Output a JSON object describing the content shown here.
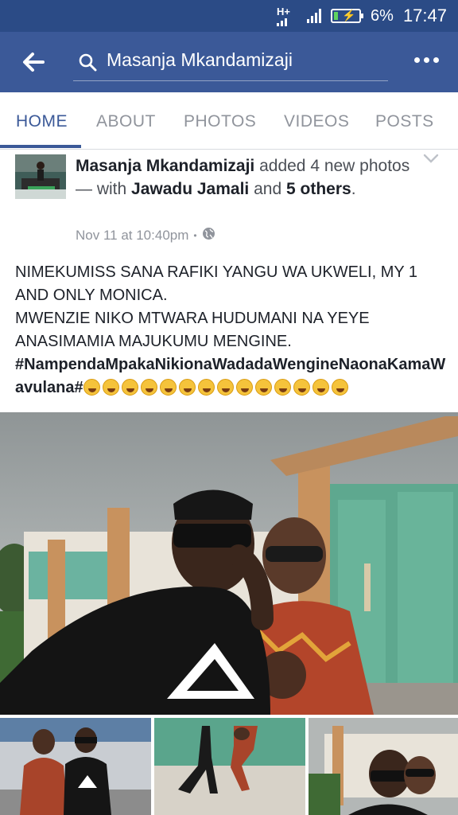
{
  "status": {
    "network": "H+",
    "battery": "6%",
    "time": "17:47"
  },
  "appbar": {
    "search_text": "Masanja Mkandamizaji"
  },
  "tabs": [
    {
      "label": "HOME"
    },
    {
      "label": "ABOUT"
    },
    {
      "label": "PHOTOS"
    },
    {
      "label": "VIDEOS"
    },
    {
      "label": "POSTS"
    }
  ],
  "post": {
    "author": "Masanja Mkandamizaji",
    "action_1": " added 4 new photos — with ",
    "tagged": "Jawadu Jamali",
    "action_2": " and ",
    "others": "5 others",
    "period": ".",
    "timestamp": "Nov 11 at 10:40pm",
    "separator": "•",
    "line1": "NIMEKUMISS SANA RAFIKI YANGU WA UKWELI, MY 1 AND ONLY MONICA.",
    "line2": "MWENZIE NIKO MTWARA HUDUMANI NA YEYE ANASIMAMIA MAJUKUMU MENGINE.",
    "hashtag": "#NampendaMpakaNikionaWadadaWengineNaonaKamaWavulana#",
    "emoji_count": 14
  },
  "colors": {
    "statusbar": "#2b4b86",
    "appbar": "#3b5998",
    "tab_active": "#3b5998",
    "tab_inactive": "#90949c"
  }
}
